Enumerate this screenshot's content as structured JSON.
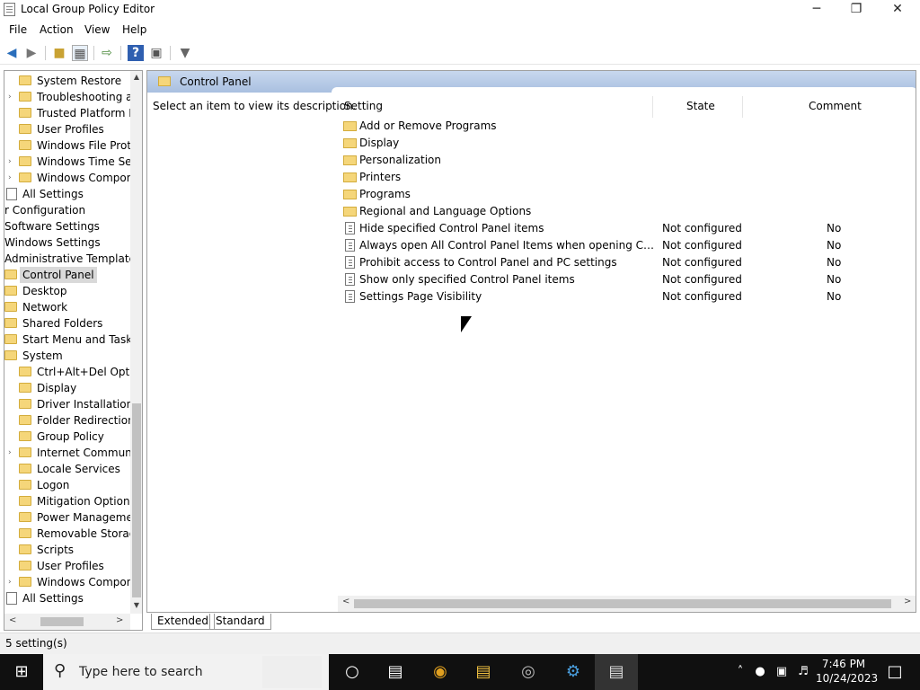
{
  "window": {
    "title": "Local Group Policy Editor",
    "minimize": "─",
    "maximize": "❐",
    "close": "✕"
  },
  "menu": [
    "File",
    "Action",
    "View",
    "Help"
  ],
  "tree": {
    "items": [
      {
        "label": "System Restore",
        "icon": "folder"
      },
      {
        "label": "Troubleshooting ar",
        "icon": "folder",
        "expander": "›"
      },
      {
        "label": "Trusted Platform M",
        "icon": "folder"
      },
      {
        "label": "User Profiles",
        "icon": "folder"
      },
      {
        "label": "Windows File Prote",
        "icon": "folder"
      },
      {
        "label": "Windows Time Ser",
        "icon": "folder",
        "expander": "›"
      },
      {
        "label": "Windows Component",
        "icon": "folder",
        "expander": "›"
      },
      {
        "label": "All Settings",
        "icon": "settings"
      },
      {
        "label": "r Configuration",
        "icon": "none"
      },
      {
        "label": "Software Settings",
        "icon": "none"
      },
      {
        "label": "Windows Settings",
        "icon": "none"
      },
      {
        "label": "Administrative Templates",
        "icon": "none"
      },
      {
        "label": "Control Panel",
        "icon": "folder",
        "selected": true
      },
      {
        "label": "Desktop",
        "icon": "folder"
      },
      {
        "label": "Network",
        "icon": "folder"
      },
      {
        "label": "Shared Folders",
        "icon": "folder"
      },
      {
        "label": "Start Menu and Taskba",
        "icon": "folder"
      },
      {
        "label": "System",
        "icon": "folder"
      },
      {
        "label": "Ctrl+Alt+Del Optic",
        "icon": "folder"
      },
      {
        "label": "Display",
        "icon": "folder"
      },
      {
        "label": "Driver Installation",
        "icon": "folder"
      },
      {
        "label": "Folder Redirection",
        "icon": "folder"
      },
      {
        "label": "Group Policy",
        "icon": "folder"
      },
      {
        "label": "Internet Communi",
        "icon": "folder",
        "expander": "›"
      },
      {
        "label": "Locale Services",
        "icon": "folder"
      },
      {
        "label": "Logon",
        "icon": "folder"
      },
      {
        "label": "Mitigation Options",
        "icon": "folder"
      },
      {
        "label": "Power Managemer",
        "icon": "folder"
      },
      {
        "label": "Removable Storage",
        "icon": "folder"
      },
      {
        "label": "Scripts",
        "icon": "folder"
      },
      {
        "label": "User Profiles",
        "icon": "folder"
      },
      {
        "label": "Windows Component",
        "icon": "folder",
        "expander": "›"
      },
      {
        "label": "All Settings",
        "icon": "settings"
      }
    ]
  },
  "pane": {
    "title": "Control Panel",
    "description": "Select an item to view its description.",
    "columns": {
      "setting": "Setting",
      "state": "State",
      "comment": "Comment"
    },
    "rows": [
      {
        "type": "folder",
        "name": "Add or Remove Programs",
        "state": "",
        "comment": ""
      },
      {
        "type": "folder",
        "name": "Display",
        "state": "",
        "comment": ""
      },
      {
        "type": "folder",
        "name": "Personalization",
        "state": "",
        "comment": ""
      },
      {
        "type": "folder",
        "name": "Printers",
        "state": "",
        "comment": ""
      },
      {
        "type": "folder",
        "name": "Programs",
        "state": "",
        "comment": ""
      },
      {
        "type": "folder",
        "name": "Regional and Language Options",
        "state": "",
        "comment": ""
      },
      {
        "type": "setting",
        "name": "Hide specified Control Panel items",
        "state": "Not configured",
        "comment": "No"
      },
      {
        "type": "setting",
        "name": "Always open All Control Panel Items when opening Control ...",
        "state": "Not configured",
        "comment": "No"
      },
      {
        "type": "setting",
        "name": "Prohibit access to Control Panel and PC settings",
        "state": "Not configured",
        "comment": "No"
      },
      {
        "type": "setting",
        "name": "Show only specified Control Panel items",
        "state": "Not configured",
        "comment": "No"
      },
      {
        "type": "setting",
        "name": "Settings Page Visibility",
        "state": "Not configured",
        "comment": "No"
      }
    ]
  },
  "tabs": {
    "extended": "Extended",
    "standard": "Standard"
  },
  "status": "5 setting(s)",
  "taskbar": {
    "search_placeholder": "Type here to search",
    "clock_time": "7:46 PM",
    "clock_date": "10/24/2023"
  }
}
